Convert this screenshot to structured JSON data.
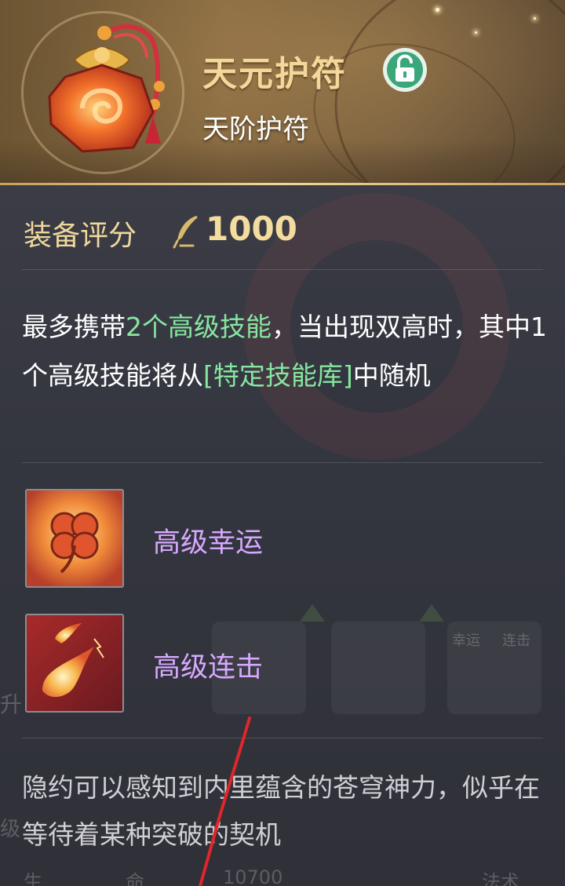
{
  "header": {
    "title": "天元护符",
    "subtitle": "天阶护符",
    "lock_icon": "unlock-icon",
    "item_icon": "amulet-pouch-icon"
  },
  "score": {
    "label": "装备评分",
    "icon": "quill-icon",
    "value": "1000"
  },
  "description": {
    "part1": "最多携带",
    "highlight1": "2个高级技能",
    "part2": "，当出现双高时，其中1个高级技能将从",
    "highlight2": "[特定技能库]",
    "part3": "中随机"
  },
  "skills": [
    {
      "name": "高级幸运",
      "icon": "clover-icon"
    },
    {
      "name": "高级连击",
      "icon": "fireball-icon"
    }
  ],
  "background_labels": {
    "tag1": "幸运",
    "tag2": "连击",
    "left_partial": "升",
    "bottom_left": "级",
    "bottom_row": [
      "生",
      "命",
      "10700",
      "法术"
    ]
  },
  "flavor_text": "隐约可以感知到内里蕴含的苍穹神力，似乎在等待着某种突破的契机",
  "colors": {
    "title_gold": "#f4d79a",
    "highlight_green": "#86e6a0",
    "skill_purple": "#d7a8ff",
    "lock_green": "#3aa77a",
    "annotation_red": "#e0262b"
  }
}
